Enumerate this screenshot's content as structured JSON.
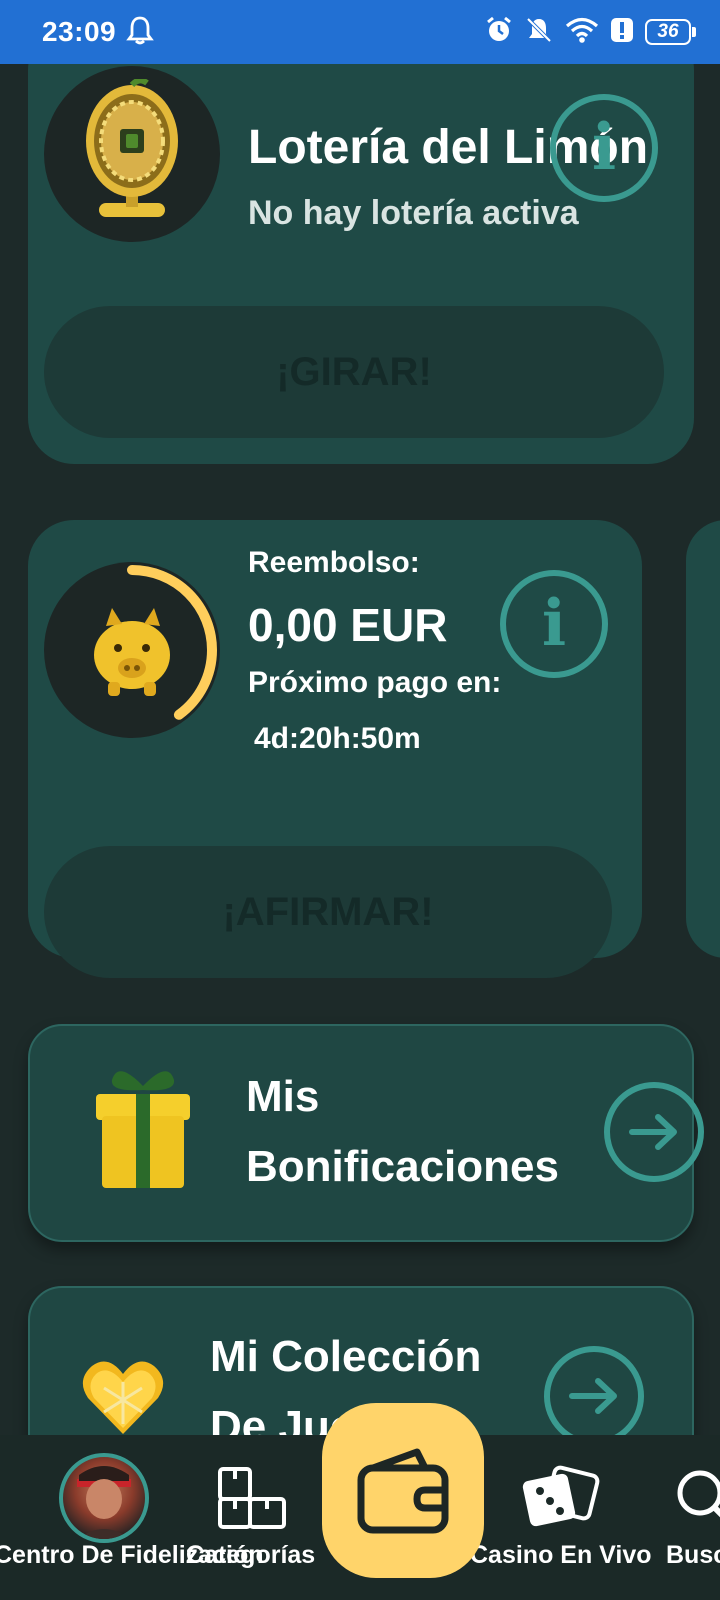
{
  "status_bar": {
    "time": "23:09",
    "battery": "36",
    "icons": [
      "bell-icon",
      "alarm-icon",
      "notifications-off-icon",
      "wifi-icon",
      "alert-icon",
      "battery-icon"
    ]
  },
  "lottery_card": {
    "title": "Lotería del Limón",
    "subtitle": "No hay lotería activa",
    "spin_label": "¡GIRAR!",
    "info_symbol": "i"
  },
  "cashback_card": {
    "label": "Reembolso:",
    "amount": "0,00 EUR",
    "next_payment_label": "Próximo pago en:",
    "countdown": "4d:20h:50m",
    "claim_label": "¡AFIRMAR!",
    "info_symbol": "i",
    "progress_fraction": 0.4
  },
  "menu": {
    "bonuses_line1": "Mis",
    "bonuses_line2": "Bonificaciones",
    "collection_line1": "Mi Colección",
    "collection_line2": "De Juegos"
  },
  "bottom_nav": {
    "loyalty_label": "Centro De Fidelización",
    "categories_label": "Categorías",
    "live_casino_label": "Casino En Vivo",
    "search_label": "Buscar"
  },
  "colors": {
    "status_bar": "#2270d3",
    "background": "#1d2a29",
    "card": "#1f4a46",
    "accent_teal": "#3a9a90",
    "wallet_yellow": "#ffd46a",
    "progress_yellow": "#ffce5c"
  }
}
